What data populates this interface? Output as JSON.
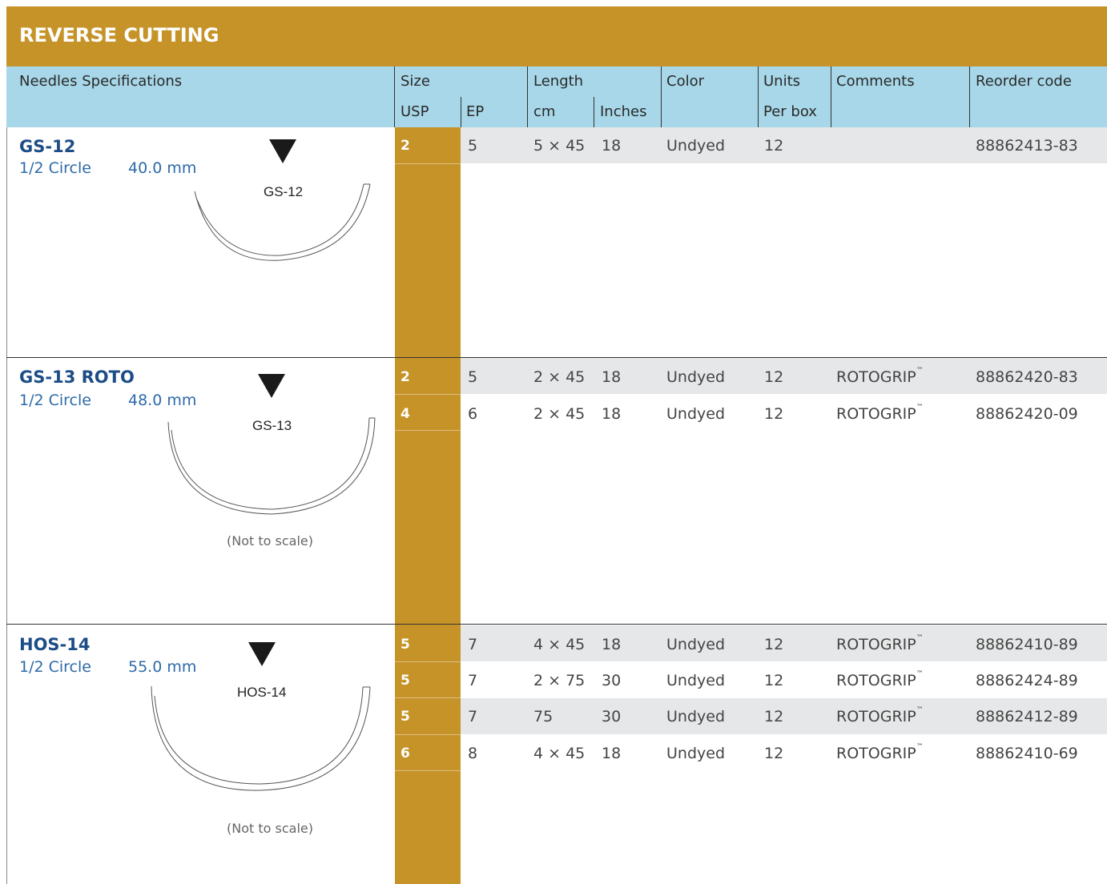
{
  "title": "REVERSE CUTTING",
  "headers": {
    "spec": "Needles Specifications",
    "size": "Size",
    "usp": "USP",
    "ep": "EP",
    "length": "Length",
    "cm": "cm",
    "inches": "Inches",
    "color": "Color",
    "units": "Units",
    "per_box": "Per box",
    "comments": "Comments",
    "reorder": "Reorder code"
  },
  "groups": [
    {
      "name": "GS-12",
      "circle": "1/2 Circle",
      "length": "40.0 mm",
      "label": "GS-12",
      "note": "",
      "rows": [
        {
          "usp": "2",
          "ep": "5",
          "cm": "5 × 45",
          "inches": "18",
          "color": "Undyed",
          "units": "12",
          "comment": "",
          "code": "88862413-83"
        }
      ]
    },
    {
      "name": "GS-13 ROTO",
      "circle": "1/2 Circle",
      "length": "48.0 mm",
      "label": "GS-13",
      "note": "(Not to scale)",
      "rows": [
        {
          "usp": "2",
          "ep": "5",
          "cm": "2 × 45",
          "inches": "18",
          "color": "Undyed",
          "units": "12",
          "comment": "ROTOGRIP",
          "code": "88862420-83"
        },
        {
          "usp": "4",
          "ep": "6",
          "cm": "2 × 45",
          "inches": "18",
          "color": "Undyed",
          "units": "12",
          "comment": "ROTOGRIP",
          "code": "88862420-09"
        }
      ]
    },
    {
      "name": "HOS-14",
      "circle": "1/2 Circle",
      "length": "55.0 mm",
      "label": "HOS-14",
      "note": "(Not to scale)",
      "rows": [
        {
          "usp": "5",
          "ep": "7",
          "cm": "4 × 45",
          "inches": "18",
          "color": "Undyed",
          "units": "12",
          "comment": "ROTOGRIP",
          "code": "88862410-89"
        },
        {
          "usp": "5",
          "ep": "7",
          "cm": "2 × 75",
          "inches": "30",
          "color": "Undyed",
          "units": "12",
          "comment": "ROTOGRIP",
          "code": "88862424-89"
        },
        {
          "usp": "5",
          "ep": "7",
          "cm": "75",
          "inches": "30",
          "color": "Undyed",
          "units": "12",
          "comment": "ROTOGRIP",
          "code": "88862412-89"
        },
        {
          "usp": "6",
          "ep": "8",
          "cm": "4 × 45",
          "inches": "18",
          "color": "Undyed",
          "units": "12",
          "comment": "ROTOGRIP",
          "code": "88862410-69"
        }
      ]
    }
  ],
  "trademark": "™",
  "colors": {
    "title_bar": "#c69328",
    "header_bg": "#a7d7e8",
    "usp_column": "#c69328",
    "stripe": "#e6e7e8",
    "needle_name": "#1c4d86",
    "needle_sub": "#2d6aa8"
  }
}
